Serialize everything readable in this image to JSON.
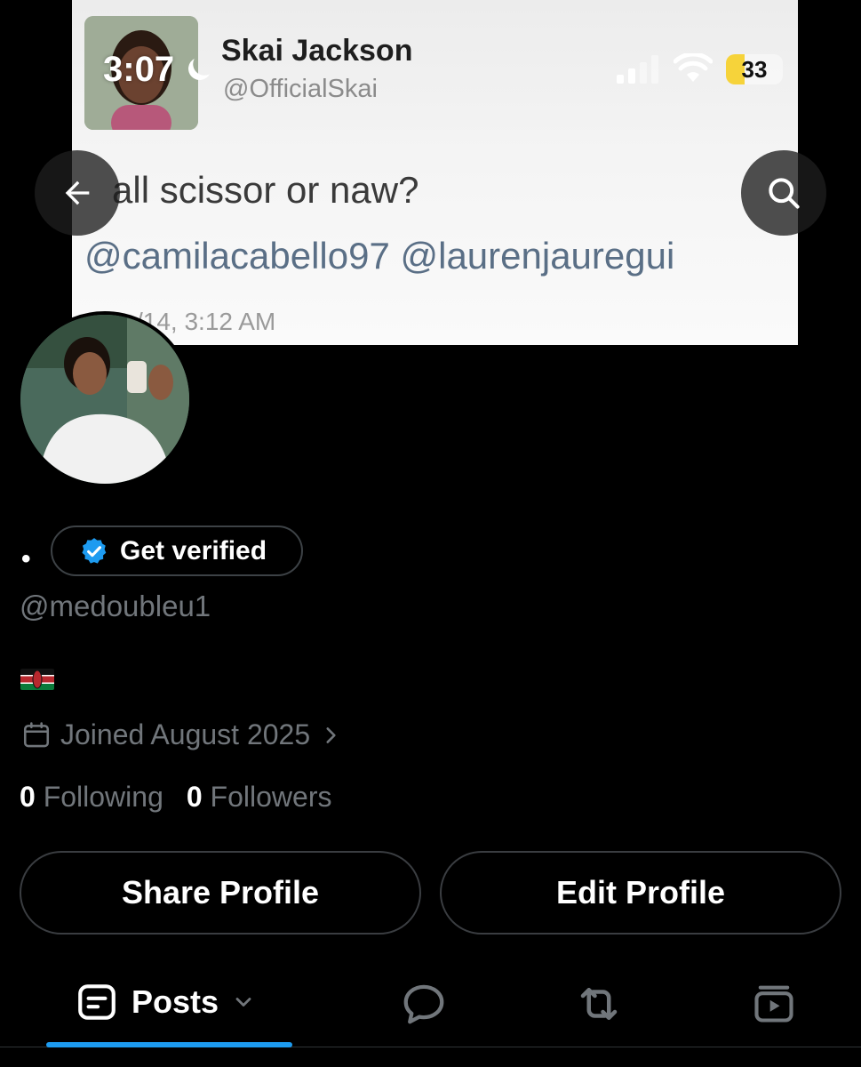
{
  "status_bar": {
    "time": "3:07",
    "battery_level": "33",
    "battery_fraction": 0.33
  },
  "banner": {
    "tweet_name": "Skai Jackson",
    "tweet_handle": "@OfficialSkai",
    "tweet_text": "all scissor or naw?",
    "tweet_mentions": "@camilacabello97 @laurenjauregui",
    "tweet_time": "/14, 3:12 AM"
  },
  "profile": {
    "display_name": "•",
    "verify_label": "Get verified",
    "handle": "@medoubleu1",
    "bio_flag": "kenya-flag",
    "joined": "Joined August 2025",
    "following_count": "0",
    "following_label": "Following",
    "followers_count": "0",
    "followers_label": "Followers"
  },
  "actions": {
    "share": "Share Profile",
    "edit": "Edit Profile"
  },
  "tabs": {
    "posts_label": "Posts"
  },
  "colors": {
    "accent": "#1d9bf0",
    "verified": "#1d9bf0",
    "muted": "#71767b",
    "battery": "#f6d33a"
  }
}
